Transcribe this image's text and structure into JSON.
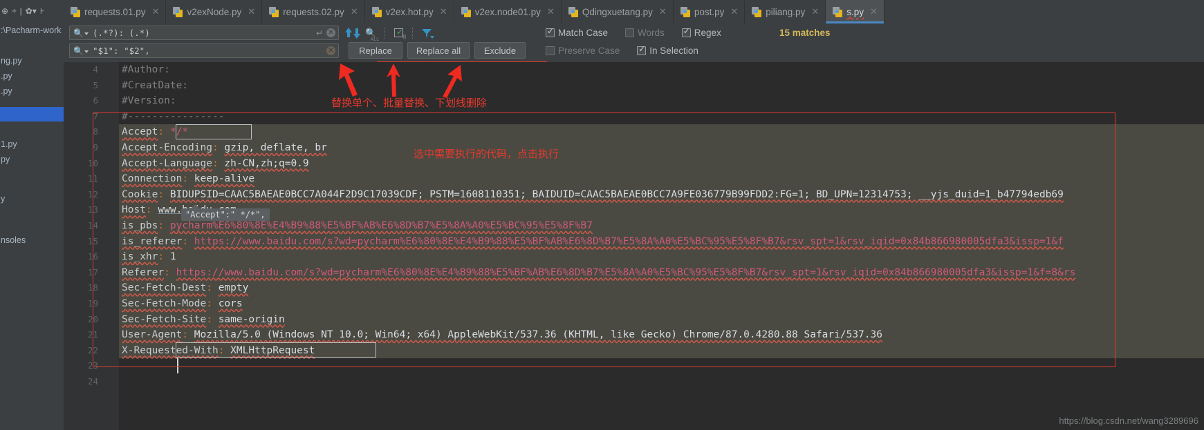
{
  "window": {
    "project_path": ":\\Pacharm-work"
  },
  "left_tree": {
    "items": [
      {
        "label": "ng.py",
        "selected": false
      },
      {
        "label": ".py",
        "selected": false
      },
      {
        "label": ".py",
        "selected": false
      },
      {
        "label": "",
        "selected": true
      },
      {
        "label": "1.py",
        "selected": false
      },
      {
        "label": "py",
        "selected": false
      },
      {
        "label": "y",
        "selected": false
      },
      {
        "label": "",
        "selected": false
      },
      {
        "label": "nsoles",
        "selected": false
      }
    ]
  },
  "tabs": [
    {
      "label": "requests.01.py",
      "active": false,
      "icon": "python-file-icon"
    },
    {
      "label": "v2exNode.py",
      "active": false,
      "icon": "python-file-icon"
    },
    {
      "label": "requests.02.py",
      "active": false,
      "icon": "python-file-icon"
    },
    {
      "label": "v2ex.hot.py",
      "active": false,
      "icon": "python-file-icon"
    },
    {
      "label": "v2ex.node01.py",
      "active": false,
      "icon": "python-file-icon"
    },
    {
      "label": "Qdingxuetang.py",
      "active": false,
      "icon": "python-file-icon"
    },
    {
      "label": "post.py",
      "active": false,
      "icon": "python-file-icon"
    },
    {
      "label": "piliang.py",
      "active": false,
      "icon": "python-file-icon"
    },
    {
      "label": "s.py",
      "active": true,
      "icon": "python-file-icon"
    }
  ],
  "find_panel": {
    "search_value": "(.*?): (.*)",
    "replace_value": "\"$1\": \"$2\",",
    "buttons": {
      "replace": "Replace",
      "replace_all": "Replace all",
      "exclude": "Exclude"
    },
    "options_row1": [
      {
        "label": "Match Case",
        "checked": true,
        "disabled": false
      },
      {
        "label": "Words",
        "checked": false,
        "disabled": true
      },
      {
        "label": "Regex",
        "checked": true,
        "disabled": false
      }
    ],
    "options_row2": [
      {
        "label": "Preserve Case",
        "checked": false,
        "disabled": true
      },
      {
        "label": "In Selection",
        "checked": true,
        "disabled": false
      }
    ],
    "match_count": "15 matches",
    "icons": {
      "search": "search-icon",
      "prev": "arrow-up-icon",
      "next": "arrow-down-icon",
      "all": "select-all-occurrences-icon",
      "in_selection": "in-selection-icon",
      "filter": "filter-icon",
      "clear": "clear-icon",
      "enter": "enter-icon"
    }
  },
  "editor": {
    "first_line_number": 4,
    "lines": [
      {
        "num": "4",
        "type": "comment",
        "text": "#Author:"
      },
      {
        "num": "5",
        "type": "comment",
        "text": "#CreatDate:"
      },
      {
        "num": "6",
        "type": "comment",
        "text": "#Version:"
      },
      {
        "num": "7",
        "type": "comment",
        "text": "#----------------"
      },
      {
        "num": "8",
        "type": "header",
        "key": "Accept",
        "value": "*/*"
      },
      {
        "num": "9",
        "type": "header",
        "key": "Accept-Encoding",
        "value": "gzip, deflate, br"
      },
      {
        "num": "10",
        "type": "header",
        "key": "Accept-Language",
        "value": "zh-CN,zh;q=0.9"
      },
      {
        "num": "11",
        "type": "header",
        "key": "Connection",
        "value": "keep-alive"
      },
      {
        "num": "12",
        "type": "header",
        "key": "Cookie",
        "value": "BIDUPSID=CAAC5BAEAE0BCC7A044F2D9C17039CDF; PSTM=1608110351; BAIDUID=CAAC5BAEAE0BCC7A9FE036779B99FDD2:FG=1; BD_UPN=12314753; __yjs_duid=1_b47794edb69"
      },
      {
        "num": "13",
        "type": "header",
        "key": "Host",
        "value": "www.baidu.com"
      },
      {
        "num": "14",
        "type": "header",
        "key": "is_pbs",
        "value": "pycharm%E6%80%8E%E4%B9%88%E5%BF%AB%E6%8D%B7%E5%8A%A0%E5%BC%95%E5%8F%B7"
      },
      {
        "num": "15",
        "type": "header",
        "key": "is_referer",
        "value": "https://www.baidu.com/s?wd=pycharm%E6%80%8E%E4%B9%88%E5%BF%AB%E6%8D%B7%E5%8A%A0%E5%BC%95%E5%8F%B7&rsv_spt=1&rsv_iqid=0x84b866980005dfa3&issp=1&f"
      },
      {
        "num": "16",
        "type": "header",
        "key": "is_xhr",
        "value": "1"
      },
      {
        "num": "17",
        "type": "header",
        "key": "Referer",
        "value": "https://www.baidu.com/s?wd=pycharm%E6%80%8E%E4%B9%88%E5%BF%AB%E6%8D%B7%E5%8A%A0%E5%BC%95%E5%8F%B7&rsv_spt=1&rsv_iqid=0x84b866980005dfa3&issp=1&f=8&rs"
      },
      {
        "num": "18",
        "type": "header",
        "key": "Sec-Fetch-Dest",
        "value": "empty"
      },
      {
        "num": "19",
        "type": "header",
        "key": "Sec-Fetch-Mode",
        "value": "cors"
      },
      {
        "num": "20",
        "type": "header",
        "key": "Sec-Fetch-Site",
        "value": "same-origin"
      },
      {
        "num": "21",
        "type": "header",
        "key": "User-Agent",
        "value": "Mozilla/5.0 (Windows NT 10.0; Win64; x64) AppleWebKit/537.36 (KHTML, like Gecko) Chrome/87.0.4280.88 Safari/537.36"
      },
      {
        "num": "22",
        "type": "header",
        "key": "X-Requested-With",
        "value": "XMLHttpRequest"
      },
      {
        "num": "23",
        "type": "blank",
        "text": ""
      },
      {
        "num": "24",
        "type": "blank",
        "text": ""
      }
    ],
    "tooltip": "\"Accept\":\" */*\","
  },
  "annotations": [
    {
      "id": "anno-replace-buttons",
      "text": "替换单个、批量替换、下划线删除"
    },
    {
      "id": "anno-run-code",
      "text": "选中需要执行的代码，点击执行"
    }
  ],
  "watermark": "https://blog.csdn.net/wang3289696",
  "colors": {
    "accent_blue": "#3592c4",
    "annotation_red": "#e8392c",
    "match_count": "#d4b85a",
    "editor_bg": "#2b2b2b",
    "panel_bg": "#3c3f41",
    "selection_bg": "#4a4a42"
  }
}
